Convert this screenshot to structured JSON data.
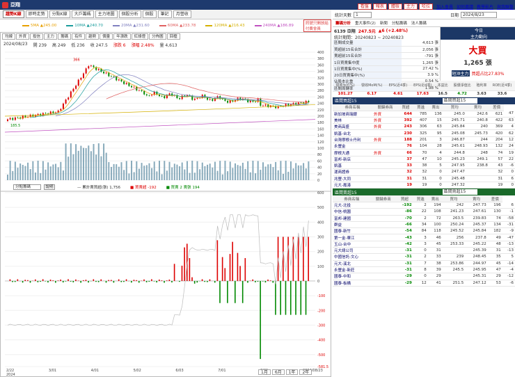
{
  "window": {
    "title": "亞翔",
    "icon_text": "亞"
  },
  "toolbar": [
    "趨勢K線",
    "即時走勢",
    "分點K線",
    "大戶籌碼",
    "主力地圖",
    "個股分析",
    "個股",
    "筆記",
    "月營收"
  ],
  "topright": {
    "buttons": [
      "看盤",
      "報表",
      "體檢",
      "主力",
      "哈拉"
    ],
    "links": [
      "加入會員",
      "如何邀請",
      "教學影片",
      "與我聯繫"
    ]
  },
  "ma_legend": [
    {
      "label": "5MA ▲245.00",
      "color": "#e8a000"
    },
    {
      "label": "10MA ▲240.70",
      "color": "#1a9c9c"
    },
    {
      "label": "20MA ▲231.60",
      "color": "#8080c0"
    },
    {
      "label": "60MA ▲233.78",
      "color": "#e06060"
    },
    {
      "label": "120MA ▲216.43",
      "color": "#d4b000"
    },
    {
      "label": "240MA ▲186.89",
      "color": "#c050c0"
    }
  ],
  "signal_text": "訊號只開放給付費會員",
  "chart_tabs": [
    "均線",
    "外資",
    "投信",
    "主力",
    "籌碼",
    "有件",
    "趨勢",
    "價量",
    "年漲跌",
    "紅綠燈",
    "分佈圖",
    "回檔"
  ],
  "chart_info": {
    "date": "2024/08/23",
    "open": "開 239",
    "high": "高 249",
    "low": "低 236",
    "close": "收 247.5",
    "change": "漲跌 6",
    "pct": "漲幅 2.48%",
    "vol": "量 4,613"
  },
  "price_labels": {
    "max": "366",
    "min": "185.5"
  },
  "indicator_select": "分點籌碼",
  "indicator_btn": "說明",
  "indicator_legend": {
    "a": "— 累計賣買超(張) 1,756",
    "b": "■ 買賣超 -192",
    "c": "■ 買賣 2 賣張 194"
  },
  "x_axis": [
    "2/22\n2024",
    "3/01",
    "4/01",
    "5/02",
    "6/03",
    "7/01",
    "8/01",
    "2024/08/23"
  ],
  "y_price": [
    "400",
    "380",
    "360",
    "340",
    "320",
    "300",
    "280",
    "260",
    "240",
    "220",
    "200",
    "180",
    "160",
    "140",
    "120",
    "100",
    "80",
    "60",
    "40",
    "20",
    "0"
  ],
  "y_ind": [
    "600",
    "500",
    "400",
    "300",
    "200",
    "100",
    "0",
    "-100",
    "-200",
    "-300",
    "-400",
    "-500",
    "-581.5"
  ],
  "range_btns": [
    "1月",
    "6月",
    "1年",
    "2年"
  ],
  "right": {
    "header": {
      "label": "統計天數",
      "days": "1",
      "date_label": "日期",
      "date": "2024/8/23"
    },
    "tabs": [
      "籌碼分析",
      "重大事件(2)",
      "新聞",
      "分點籌碼",
      "法人籌碼"
    ],
    "stock": {
      "code": "6139 亞翔",
      "price": "247.5元",
      "change": "▲6 (+2.48%)"
    },
    "range": "統計期間：20240823 ~ 20240823",
    "stats": [
      [
        "區間成交量",
        "4,613 張"
      ],
      [
        "買超前15名合計",
        "2,056 張"
      ],
      [
        "賣超前15名合計",
        "-791 張"
      ],
      [
        "1日買賣集中度",
        "1,265 張"
      ],
      [
        "1日買賣集中(%)",
        "27.42 %"
      ],
      [
        "20日買賣集中(%)",
        "3.9 %"
      ],
      [
        "佔股本比重",
        "0.54 %"
      ],
      [
        "區間周轉率",
        "1.98 %"
      ]
    ],
    "today": {
      "label": "今日",
      "sub": "主力動向",
      "main": "大買",
      "vol": "1,265 張",
      "short_lbl": "短沖主力",
      "short_val": "買超占比27.83%"
    },
    "fund_head": [
      "營收YoY(%)",
      "營收MoM(%)",
      "EPS(近4季)",
      "EPS(近4季)",
      "本益比",
      "股價淨值比",
      "殖利率",
      "ROE(近4季)"
    ],
    "fund_vals": [
      "101.27",
      "6.17",
      "4.61",
      "17.63",
      "16.5",
      "4.72",
      "3.63",
      "33.6"
    ],
    "buy_title": "區間買超15",
    "buy_select": "區間買超15",
    "col_head": [
      "券商名稱",
      "關鍵券商",
      "買超",
      "買進",
      "賣出",
      "買均",
      "賣均",
      "差價"
    ],
    "buy": [
      [
        "新加坡商瑞銀",
        "外資",
        "644",
        "785",
        "136",
        "245.0",
        "242.6",
        "621",
        "47"
      ],
      [
        "美林",
        "外資",
        "392",
        "407",
        "15",
        "245.71",
        "240.8",
        "422",
        "63"
      ],
      [
        "美商高盛",
        "外資",
        "243",
        "306",
        "63",
        "245.84",
        "240",
        "369",
        "4"
      ],
      [
        "凱基-台北",
        "",
        "230",
        "325",
        "95",
        "245.08",
        "245.73",
        "420",
        "62"
      ],
      [
        "台灣摩根士丹利",
        "外資",
        "188",
        "201",
        "3",
        "246.87",
        "244",
        "204",
        "12"
      ],
      [
        "永豐金",
        "",
        "76",
        "104",
        "28",
        "245.61",
        "248.93",
        "132",
        "24"
      ],
      [
        "摩根大通",
        "外資",
        "66",
        "70",
        "4",
        "244.8",
        "248",
        "74",
        "19"
      ],
      [
        "富邦-新店",
        "",
        "37",
        "47",
        "10",
        "245.23",
        "249.1",
        "57",
        "22"
      ],
      [
        "凱基",
        "",
        "33",
        "38",
        "5",
        "247.95",
        "238.8",
        "43",
        "-6"
      ],
      [
        "運商證券",
        "",
        "32",
        "32",
        "0",
        "247.47",
        "",
        "32",
        "0"
      ],
      [
        "兆豐-大同",
        "",
        "31",
        "31",
        "0",
        "245.48",
        "",
        "31",
        "6"
      ],
      [
        "元大-鳳港",
        "",
        "19",
        "19",
        "0",
        "247.32",
        "",
        "19",
        "0"
      ]
    ],
    "sell_title": "區間賣超15",
    "sell_select": "區間賣超15",
    "sell": [
      [
        "元大-北投",
        "",
        "-192",
        "2",
        "194",
        "242",
        "247.73",
        "196",
        "6"
      ],
      [
        "中信-桃園",
        "",
        "-86",
        "22",
        "108",
        "241.23",
        "247.61",
        "130",
        "-1"
      ],
      [
        "富邦-建國",
        "",
        "-70",
        "2",
        "72",
        "263.5",
        "239.83",
        "74",
        "-58"
      ],
      [
        "群益",
        "",
        "-66",
        "34",
        "100",
        "250.24",
        "245.37",
        "134",
        "-31"
      ],
      [
        "國泰-新竹",
        "",
        "-54",
        "84",
        "118",
        "245.52",
        "245.84",
        "182",
        "-9"
      ],
      [
        "第一金-華江",
        "",
        "-43",
        "3",
        "46",
        "256",
        "237.8",
        "49",
        "-47"
      ],
      [
        "玉山-台中",
        "",
        "-42",
        "3",
        "45",
        "253.33",
        "245.22",
        "48",
        "-13"
      ],
      [
        "元大總公司",
        "",
        "-31",
        "0",
        "31",
        "",
        "245.39",
        "31",
        "-13"
      ],
      [
        "中國信託-文心",
        "",
        "-31",
        "2",
        "33",
        "239",
        "248.45",
        "35",
        "5"
      ],
      [
        "元大-溪北",
        "",
        "-31",
        "7",
        "38",
        "253.86",
        "244.97",
        "45",
        "-14"
      ],
      [
        "永豐金-新莊",
        "",
        "-31",
        "8",
        "39",
        "245.5",
        "245.95",
        "47",
        "-4"
      ],
      [
        "國泰-中和",
        "",
        "-29",
        "0",
        "29",
        "",
        "245.31",
        "29",
        "-12"
      ],
      [
        "國泰-板橋",
        "",
        "-29",
        "12",
        "41",
        "251.5",
        "247.12",
        "53",
        "-6"
      ]
    ]
  }
}
